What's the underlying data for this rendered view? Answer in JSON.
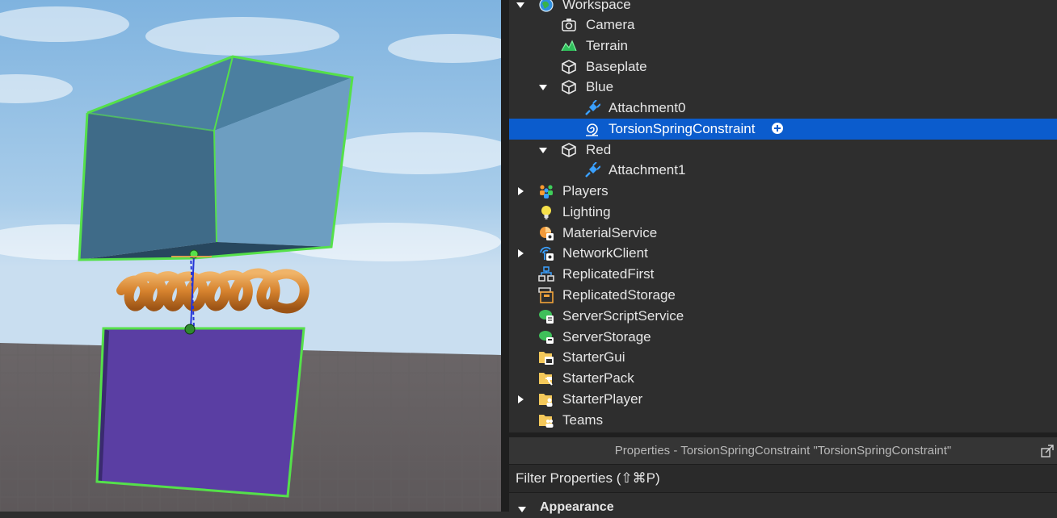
{
  "explorer": {
    "items": [
      {
        "label": "Workspace",
        "icon": "workspace-icon",
        "expanded": true
      },
      {
        "label": "Camera",
        "icon": "camera-icon"
      },
      {
        "label": "Terrain",
        "icon": "terrain-icon"
      },
      {
        "label": "Baseplate",
        "icon": "part-icon"
      },
      {
        "label": "Blue",
        "icon": "part-icon",
        "expanded": true
      },
      {
        "label": "Attachment0",
        "icon": "attachment-icon"
      },
      {
        "label": "TorsionSpringConstraint",
        "icon": "torsion-spring-icon",
        "selected": true
      },
      {
        "label": "Red",
        "icon": "part-icon",
        "expanded": true
      },
      {
        "label": "Attachment1",
        "icon": "attachment-icon"
      },
      {
        "label": "Players",
        "icon": "players-icon",
        "expanded": false
      },
      {
        "label": "Lighting",
        "icon": "lighting-icon"
      },
      {
        "label": "MaterialService",
        "icon": "material-service-icon"
      },
      {
        "label": "NetworkClient",
        "icon": "network-client-icon",
        "expanded": false
      },
      {
        "label": "ReplicatedFirst",
        "icon": "replicated-first-icon"
      },
      {
        "label": "ReplicatedStorage",
        "icon": "replicated-storage-icon"
      },
      {
        "label": "ServerScriptService",
        "icon": "server-script-service-icon"
      },
      {
        "label": "ServerStorage",
        "icon": "server-storage-icon"
      },
      {
        "label": "StarterGui",
        "icon": "starter-gui-icon"
      },
      {
        "label": "StarterPack",
        "icon": "starter-pack-icon"
      },
      {
        "label": "StarterPlayer",
        "icon": "starter-player-icon",
        "expanded": false
      },
      {
        "label": "Teams",
        "icon": "teams-icon"
      }
    ]
  },
  "properties": {
    "title": "Properties - TorsionSpringConstraint \"TorsionSpringConstraint\"",
    "filter_placeholder": "Filter Properties (⇧⌘P)",
    "category": "Appearance"
  },
  "colors": {
    "selection": "#0b5ccd",
    "panel_bg": "#2e2e2e",
    "text": "#e6e6e6",
    "selection_outline": "#55e04a"
  }
}
